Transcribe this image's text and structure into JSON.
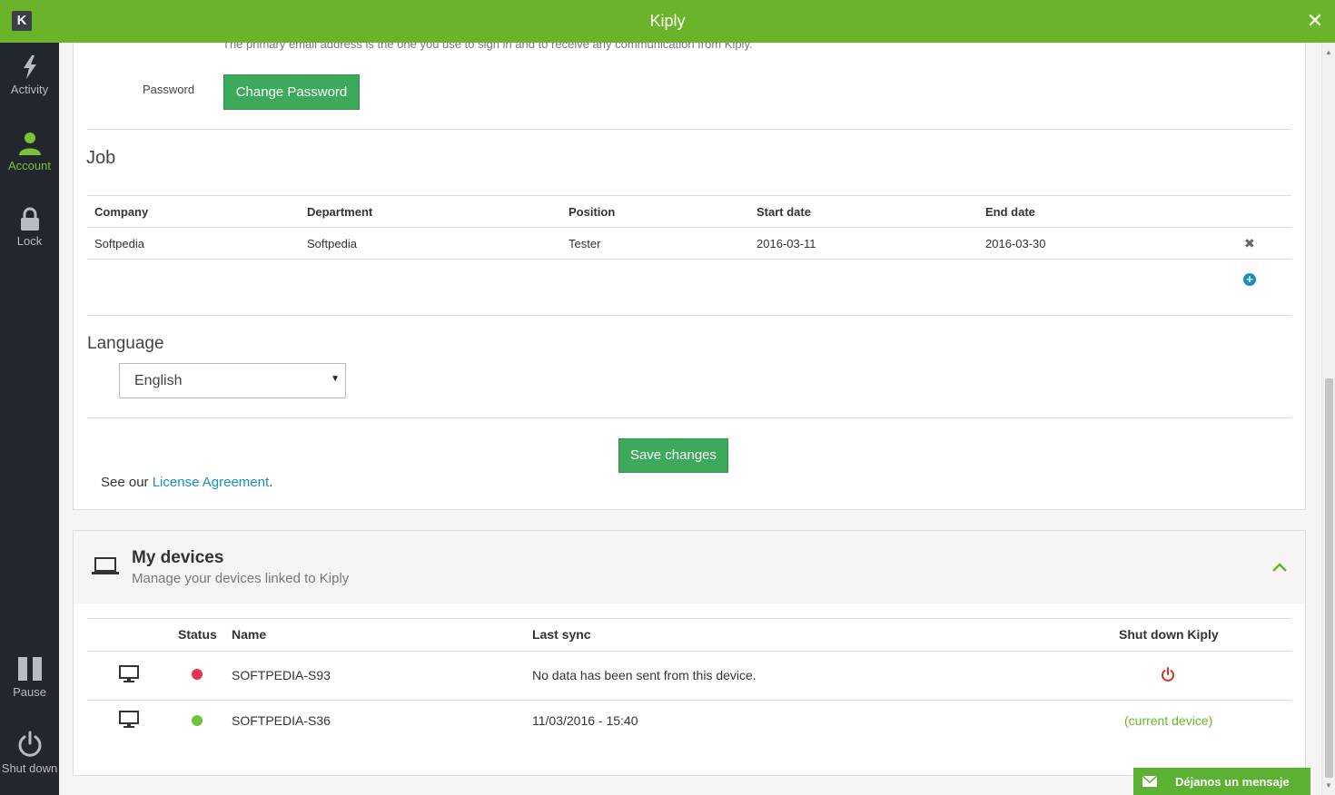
{
  "window": {
    "title": "Kiply",
    "logo_letter": "K",
    "close": "✕"
  },
  "sidebar": {
    "items": [
      {
        "label": "Activity",
        "icon": "lightning-icon"
      },
      {
        "label": "Account",
        "icon": "user-icon",
        "active": true
      },
      {
        "label": "Lock",
        "icon": "lock-icon"
      },
      {
        "label": "Pause",
        "icon": "pause-icon"
      },
      {
        "label": "Shut down",
        "icon": "power-icon"
      }
    ]
  },
  "account": {
    "email_hint": "The primary email address is the one you use to sign in and to receive any communication from Kiply.",
    "password_label": "Password",
    "change_password_label": "Change Password"
  },
  "job": {
    "title": "Job",
    "columns": [
      "Company",
      "Department",
      "Position",
      "Start date",
      "End date"
    ],
    "rows": [
      {
        "company": "Softpedia",
        "department": "Softpedia",
        "position": "Tester",
        "start_date": "2016-03-11",
        "end_date": "2016-03-30"
      }
    ]
  },
  "language": {
    "title": "Language",
    "selected": "English"
  },
  "save_changes_label": "Save changes",
  "license": {
    "prefix": "See our ",
    "link": "License Agreement",
    "suffix": "."
  },
  "devices": {
    "title": "My devices",
    "subtitle": "Manage your devices linked to Kiply",
    "columns": {
      "status": "Status",
      "name": "Name",
      "last_sync": "Last sync",
      "shutdown": "Shut down Kiply"
    },
    "rows": [
      {
        "name": "SOFTPEDIA-S93",
        "status_color": "#e8334a",
        "last_sync": "No data has been sent from this device.",
        "shutdown": "power-button"
      },
      {
        "name": "SOFTPEDIA-S36",
        "status_color": "#6fc43a",
        "last_sync": "11/03/2016 - 15:40",
        "shutdown": "(current device)"
      }
    ]
  },
  "message_button": {
    "label": "Déjanos un mensaje",
    "icon": "mail-icon"
  },
  "colors": {
    "brand_green": "#6bb42a",
    "button_green": "#3caa5a",
    "link_blue": "#1a8fbc",
    "sidebar_bg": "#22272e"
  }
}
